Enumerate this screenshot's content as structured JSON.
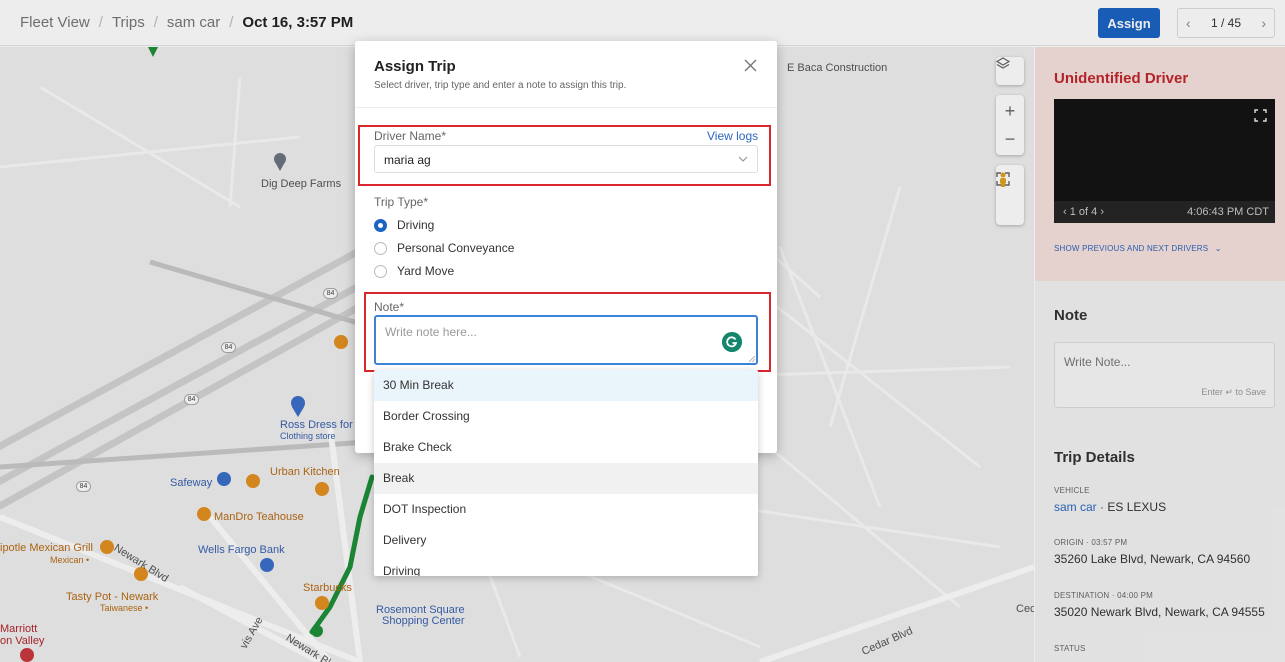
{
  "header": {
    "breadcrumbs": [
      "Fleet View",
      "Trips",
      "sam car"
    ],
    "current": "Oct 16, 3:57 PM",
    "assign_label": "Assign",
    "pager": "1 / 45"
  },
  "map": {
    "labels": {
      "baca": "E Baca Construction",
      "digdeep": "Dig Deep Farms",
      "ross": "Ross Dress for",
      "ross_sub": "Clothing store",
      "urban": "Urban Kitchen",
      "safeway": "Safeway",
      "mandro": "ManDro Teahouse",
      "chipotle": "ipotle Mexican Grill",
      "chipotle_sub": "Mexican •",
      "newark_blvd": "Newark Blvd",
      "wells": "Wells Fargo Bank",
      "tasty": "Tasty Pot - Newark",
      "tasty_sub": "Taiwanese •",
      "starbucks": "Starbucks",
      "rosemont": "Rosemont Square",
      "rosemont_sub": "Shopping Center",
      "marriott": "Marriott",
      "marriott_sub": "on Valley",
      "newark_blvd2": "Newark Bl",
      "avis": "vis Ave",
      "cedar": "Cedar Blvd",
      "cec": "Cec"
    },
    "shields": [
      "84",
      "84",
      "84",
      "84"
    ]
  },
  "modal": {
    "title": "Assign Trip",
    "subtitle": "Select driver, trip type and enter a note to assign this trip.",
    "driver_label": "Driver Name*",
    "view_logs": "View logs",
    "driver_value": "maria ag",
    "trip_type_label": "Trip Type*",
    "trip_types": [
      "Driving",
      "Personal Conveyance",
      "Yard Move"
    ],
    "selected_trip_type": "Driving",
    "note_label": "Note*",
    "note_placeholder": "Write note here..."
  },
  "dropdown": {
    "items": [
      "30 Min Break",
      "Border Crossing",
      "Brake Check",
      "Break",
      "DOT Inspection",
      "Delivery",
      "Driving"
    ]
  },
  "right_panel": {
    "driver_title": "Unidentified Driver",
    "video_counter": "1 of 4",
    "video_time": "4:06:43 PM CDT",
    "show_prev": "SHOW PREVIOUS AND NEXT DRIVERS",
    "note_heading": "Note",
    "note_placeholder": "Write Note...",
    "note_hint": "Enter ↵ to Save",
    "trip_details_heading": "Trip Details",
    "vehicle_label": "VEHICLE",
    "vehicle_name": "sam car",
    "vehicle_model": "ES LEXUS",
    "origin_label": "ORIGIN",
    "origin_time": "03:57 PM",
    "origin_address": "35260 Lake Blvd, Newark, CA 94560",
    "destination_label": "DESTINATION",
    "destination_time": "04:00 PM",
    "destination_address": "35020 Newark Blvd, Newark, CA 94555",
    "status_label": "STATUS"
  },
  "colors": {
    "accent": "#1a64c4",
    "danger": "#d9272e",
    "route": "#1e8f3a",
    "driver_title": "#c0272d"
  }
}
